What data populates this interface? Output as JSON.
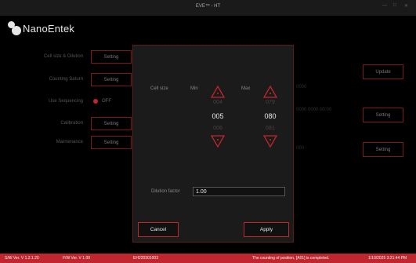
{
  "window": {
    "title": "EVE™ - HT",
    "controls": [
      "—",
      "□",
      "✕"
    ]
  },
  "app": {
    "brand": "NanoEntek"
  },
  "background": {
    "rows": [
      {
        "label": "Cell size & Dilution",
        "button": "Setting"
      },
      {
        "label": "Counting Saturn",
        "button": "Setting"
      },
      {
        "label": "Use Sequencing",
        "toggle": "OFF"
      },
      {
        "label": "Calibration",
        "button": "Setting"
      },
      {
        "label": "Maintenance",
        "button": "Setting"
      }
    ],
    "right_buttons": [
      "Update",
      "Setting",
      "Setting"
    ],
    "faint": [
      "0000",
      "0000 0000 00:00",
      "000"
    ]
  },
  "dialog": {
    "cell_size_label": "Cell size",
    "min": {
      "label": "Min",
      "prev": "004",
      "value": "005",
      "next": "006"
    },
    "max": {
      "label": "Max",
      "prev": "079",
      "value": "080",
      "next": "081"
    },
    "dilution": {
      "label": "Dilution factor",
      "value": "1.00"
    },
    "cancel": "Cancel",
    "apply": "Apply"
  },
  "status_bar": {
    "sw": "S/W Ver. V 1.2.1.20",
    "fw": "F/W Ver. V 1.00",
    "device": "EH220301003",
    "message": "The counting of position, [A01] is completed.",
    "datetime": "1/10/2025 3:21:44 PM"
  },
  "colors": {
    "accent": "#c0262d",
    "panel": "#1b1b1b"
  }
}
